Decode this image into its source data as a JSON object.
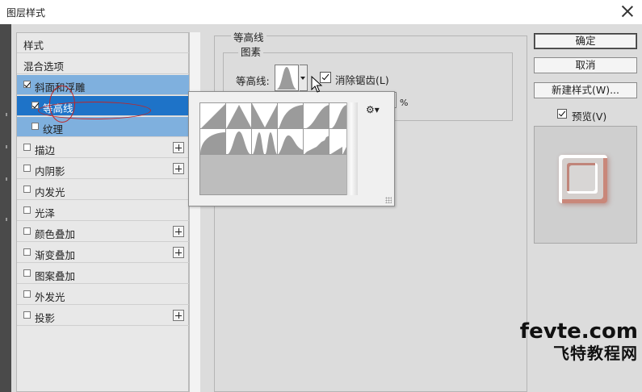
{
  "window": {
    "title": "图层样式"
  },
  "style_list": {
    "header": "样式",
    "blend_options": "混合选项",
    "items": [
      {
        "label": "斜面和浮雕",
        "checked": true,
        "state": "selected-parent"
      },
      {
        "label": "等高线",
        "checked": true,
        "state": "selected"
      },
      {
        "label": "纹理",
        "checked": false,
        "state": "selected-child"
      },
      {
        "label": "描边",
        "checked": false,
        "has_add": true
      },
      {
        "label": "内阴影",
        "checked": false,
        "has_add": true
      },
      {
        "label": "内发光",
        "checked": false
      },
      {
        "label": "光泽",
        "checked": false
      },
      {
        "label": "颜色叠加",
        "checked": false,
        "has_add": true
      },
      {
        "label": "渐变叠加",
        "checked": false,
        "has_add": true
      },
      {
        "label": "图案叠加",
        "checked": false
      },
      {
        "label": "外发光",
        "checked": false
      },
      {
        "label": "投影",
        "checked": false,
        "has_add": true
      }
    ]
  },
  "panel": {
    "group_title": "等高线",
    "sub_group_title": "图素",
    "contour_label": "等高线:",
    "anti_alias_label": "消除锯齿(L)",
    "anti_alias_checked": true,
    "range_unit": "%",
    "range_value": ""
  },
  "contour_picker": {
    "gear_icon": "gear-icon",
    "rows": [
      [
        "linear",
        "cone",
        "cone-inverted",
        "cove-deep",
        "cove-shallow",
        "gaussian"
      ],
      [
        "half-round",
        "ring",
        "ring-double",
        "rolling-slope",
        "rounded-steps",
        "sawtooth"
      ]
    ],
    "highlighted": "ring"
  },
  "buttons": {
    "ok": "确定",
    "cancel": "取消",
    "new_style": "新建样式(W)..."
  },
  "preview": {
    "label": "预览(V)",
    "checked": true
  },
  "watermark": {
    "line1": "fevte.com",
    "line2": "飞特教程网"
  },
  "colors": {
    "selection_dark": "#1e73c8",
    "selection_light": "#7fb0de",
    "annotation_red": "#c02626"
  }
}
